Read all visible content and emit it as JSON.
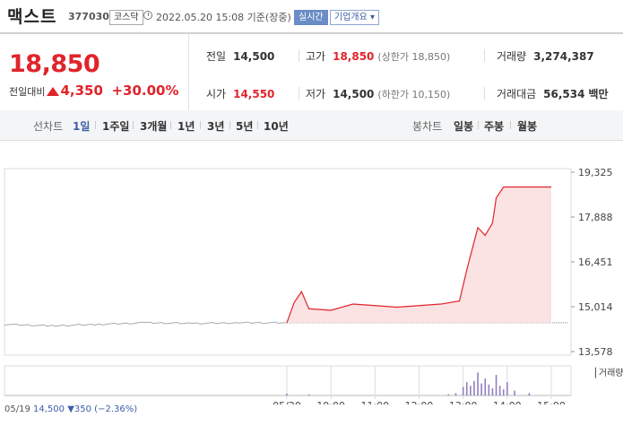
{
  "header": {
    "stock_name": "맥스트",
    "stock_code": "377030",
    "market": "코스닥",
    "as_of": "2022.05.20 15:08 기준(장중)",
    "live_label": "실시간",
    "company_label": "기업개요 ▾"
  },
  "quote": {
    "price": "18,850",
    "change_label": "전일대비",
    "change": "4,350",
    "change_pct": "+30.00%",
    "prev_close_label": "전일",
    "prev_close": "14,500",
    "open_label": "시가",
    "open": "14,550",
    "high_label": "고가",
    "high": "18,850",
    "upper_limit": "(상한가 18,850)",
    "low_label": "저가",
    "low": "14,500",
    "lower_limit": "(하한가 10,150)",
    "volume_label": "거래량",
    "volume": "3,274,387",
    "amount_label": "거래대금",
    "amount": "56,534",
    "amount_unit": "백만"
  },
  "tabs": {
    "line_label": "선차트",
    "line_periods": [
      "1일",
      "1주일",
      "3개월",
      "1년",
      "3년",
      "5년",
      "10년"
    ],
    "candle_label": "봉차트",
    "candle_periods": [
      "일봉",
      "주봉",
      "월봉"
    ]
  },
  "chart_data": {
    "type": "area",
    "y_ticks": [
      "19,325",
      "17,888",
      "16,451",
      "15,014",
      "13,578"
    ],
    "ylim": [
      13578,
      19325
    ],
    "x_ticks": [
      "05/20",
      "10:00",
      "11:00",
      "12:00",
      "13:00",
      "14:00",
      "15:00"
    ],
    "reference_line": 14500,
    "prev_day_series": {
      "x": [
        "05/19 09:00",
        "05/19 10:00",
        "05/19 11:00",
        "05/19 12:00",
        "05/19 13:00",
        "05/19 14:00",
        "05/19 15:00"
      ],
      "values": [
        14450,
        14400,
        14450,
        14500,
        14480,
        14500,
        14500
      ]
    },
    "today_series": {
      "x": [
        "09:00",
        "09:10",
        "09:20",
        "09:30",
        "10:00",
        "10:30",
        "11:00",
        "11:30",
        "12:00",
        "12:30",
        "12:55",
        "13:05",
        "13:15",
        "13:20",
        "13:30",
        "13:40",
        "13:45",
        "13:55",
        "14:05",
        "15:00"
      ],
      "values": [
        14500,
        15150,
        15500,
        14950,
        14900,
        15100,
        15050,
        15000,
        15050,
        15100,
        15200,
        16200,
        17100,
        17550,
        17300,
        17700,
        18500,
        18850,
        18850,
        18850
      ]
    },
    "volume_label": "거래량",
    "volume": {
      "x": [
        "09:00",
        "09:30",
        "12:40",
        "12:50",
        "13:00",
        "13:05",
        "13:10",
        "13:15",
        "13:20",
        "13:25",
        "13:30",
        "13:35",
        "13:40",
        "13:45",
        "13:50",
        "13:55",
        "14:00",
        "14:10",
        "14:30"
      ],
      "values": [
        0.08,
        0.05,
        0.05,
        0.1,
        0.35,
        0.55,
        0.4,
        0.6,
        0.95,
        0.5,
        0.7,
        0.45,
        0.3,
        0.85,
        0.4,
        0.25,
        0.55,
        0.2,
        0.1
      ]
    },
    "colors": {
      "up": "#e0242b",
      "fill": "#fbe2e3",
      "prev": "#aaaaaa",
      "volume": "#8f7fc0"
    }
  },
  "footer": {
    "date": "05/19",
    "close": "14,500",
    "change": "▼350",
    "change_pct": "(−2.36%)"
  }
}
